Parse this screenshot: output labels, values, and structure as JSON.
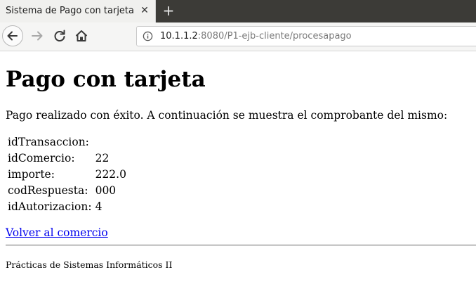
{
  "browser": {
    "tab": {
      "title": "Sistema de Pago con tarjeta",
      "close_glyph": "✕"
    },
    "new_tab_glyph": "+",
    "toolbar": {
      "back_icon": "arrow-left-icon",
      "forward_icon": "arrow-right-icon",
      "reload_icon": "reload-icon",
      "home_icon": "home-icon"
    },
    "address_bar": {
      "info_icon": "info-icon",
      "host": "10.1.1.2",
      "rest": ":8080/P1-ejb-cliente/procesapago"
    }
  },
  "page": {
    "title": "Pago con tarjeta",
    "intro": "Pago realizado con éxito. A continuación se muestra el comprobante del mismo:",
    "receipt": [
      {
        "label": "idTransaccion:",
        "value": ""
      },
      {
        "label": "idComercio:",
        "value": "22"
      },
      {
        "label": "importe:",
        "value": "222.0"
      },
      {
        "label": "codRespuesta:",
        "value": "000"
      },
      {
        "label": "idAutorizacion:",
        "value": "4"
      }
    ],
    "back_link": "Volver al comercio",
    "footer": "Prácticas de Sistemas Informáticos II"
  }
}
